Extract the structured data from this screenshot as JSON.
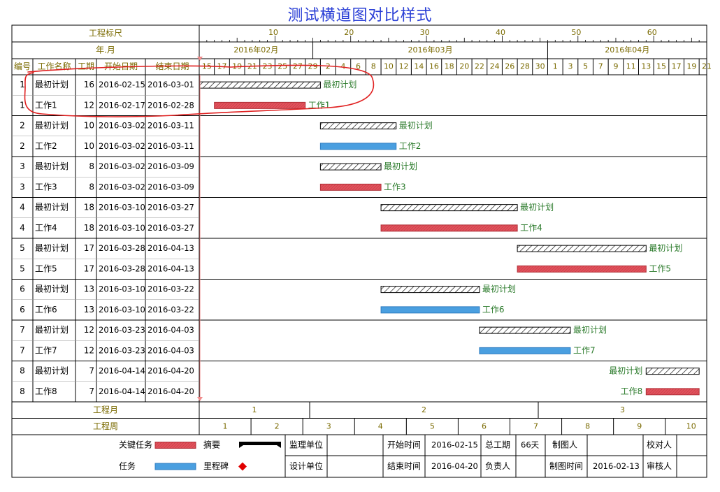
{
  "title": "测试横道图对比样式",
  "header": {
    "scale_label": "工程标尺",
    "month_label": "年.月",
    "col_no": "编号",
    "col_name": "工作名称",
    "col_dur": "工期",
    "col_start": "开始日期",
    "col_end": "结束日期"
  },
  "chart_data": {
    "type": "gantt",
    "date_range": [
      "2016-02-15",
      "2016-04-21"
    ],
    "scale_ticks": [
      10,
      20,
      30,
      40,
      50,
      60
    ],
    "months": [
      {
        "label": "2016年02月",
        "start": "2016-02-15",
        "end": "2016-02-29"
      },
      {
        "label": "2016年03月",
        "start": "2016-03-01",
        "end": "2016-03-31"
      },
      {
        "label": "2016年04月",
        "start": "2016-04-01",
        "end": "2016-04-21"
      }
    ],
    "day_labels": [
      "15",
      "17",
      "19",
      "21",
      "23",
      "25",
      "27",
      "29",
      "2",
      "4",
      "6",
      "8",
      "10",
      "12",
      "14",
      "16",
      "18",
      "20",
      "22",
      "24",
      "26",
      "28",
      "30",
      "1",
      "3",
      "5",
      "7",
      "9",
      "11",
      "13",
      "15",
      "17",
      "19",
      "21"
    ],
    "rows": [
      {
        "no": "1",
        "name": "最初计划",
        "dur": "16",
        "start": "2016-02-15",
        "end": "2016-03-01",
        "kind": "baseline"
      },
      {
        "no": "1",
        "name": "工作1",
        "dur": "12",
        "start": "2016-02-17",
        "end": "2016-02-28",
        "kind": "critical"
      },
      {
        "no": "2",
        "name": "最初计划",
        "dur": "10",
        "start": "2016-03-02",
        "end": "2016-03-11",
        "kind": "baseline"
      },
      {
        "no": "2",
        "name": "工作2",
        "dur": "10",
        "start": "2016-03-02",
        "end": "2016-03-11",
        "kind": "task"
      },
      {
        "no": "3",
        "name": "最初计划",
        "dur": "8",
        "start": "2016-03-02",
        "end": "2016-03-09",
        "kind": "baseline"
      },
      {
        "no": "3",
        "name": "工作3",
        "dur": "8",
        "start": "2016-03-02",
        "end": "2016-03-09",
        "kind": "critical"
      },
      {
        "no": "4",
        "name": "最初计划",
        "dur": "18",
        "start": "2016-03-10",
        "end": "2016-03-27",
        "kind": "baseline"
      },
      {
        "no": "4",
        "name": "工作4",
        "dur": "18",
        "start": "2016-03-10",
        "end": "2016-03-27",
        "kind": "critical"
      },
      {
        "no": "5",
        "name": "最初计划",
        "dur": "17",
        "start": "2016-03-28",
        "end": "2016-04-13",
        "kind": "baseline"
      },
      {
        "no": "5",
        "name": "工作5",
        "dur": "17",
        "start": "2016-03-28",
        "end": "2016-04-13",
        "kind": "critical"
      },
      {
        "no": "6",
        "name": "最初计划",
        "dur": "13",
        "start": "2016-03-10",
        "end": "2016-03-22",
        "kind": "baseline"
      },
      {
        "no": "6",
        "name": "工作6",
        "dur": "13",
        "start": "2016-03-10",
        "end": "2016-03-22",
        "kind": "task"
      },
      {
        "no": "7",
        "name": "最初计划",
        "dur": "12",
        "start": "2016-03-23",
        "end": "2016-04-03",
        "kind": "baseline"
      },
      {
        "no": "7",
        "name": "工作7",
        "dur": "12",
        "start": "2016-03-23",
        "end": "2016-04-03",
        "kind": "task"
      },
      {
        "no": "8",
        "name": "最初计划",
        "dur": "7",
        "start": "2016-04-14",
        "end": "2016-04-20",
        "kind": "baseline",
        "label_left": true
      },
      {
        "no": "8",
        "name": "工作8",
        "dur": "7",
        "start": "2016-04-14",
        "end": "2016-04-20",
        "kind": "critical",
        "label_left": true
      }
    ],
    "project_month": {
      "label": "工程月",
      "values": [
        "1",
        "2",
        "3"
      ]
    },
    "project_week": {
      "label": "工程周",
      "values": [
        "1",
        "2",
        "3",
        "4",
        "5",
        "6",
        "7",
        "8",
        "9",
        "10"
      ]
    }
  },
  "legend": {
    "critical_label": "关键任务",
    "task_label": "任务",
    "summary_label": "摘要",
    "milestone_label": "里程碑"
  },
  "info": {
    "supervisor_label": "监理单位",
    "designer_label": "设计单位",
    "start_time_label": "开始时间",
    "start_time": "2016-02-15",
    "end_time_label": "结束时间",
    "end_time": "2016-04-20",
    "total_label": "总工期",
    "total": "66天",
    "owner_label": "负责人",
    "drawer_label": "制图人",
    "draw_time_label": "制图时间",
    "draw_time": "2016-02-13",
    "checker_label": "校对人",
    "reviewer_label": "审核人"
  },
  "colors": {
    "critical": "#e0525c",
    "task": "#4a9fe0",
    "baseline_hatch": "#000000",
    "grid": "#000000",
    "label_green": "#2a7a2a",
    "header_olive": "#7a6a00",
    "title_blue": "#2a3fd6",
    "annotation_red": "#e02020",
    "milestone": "#e00000"
  }
}
